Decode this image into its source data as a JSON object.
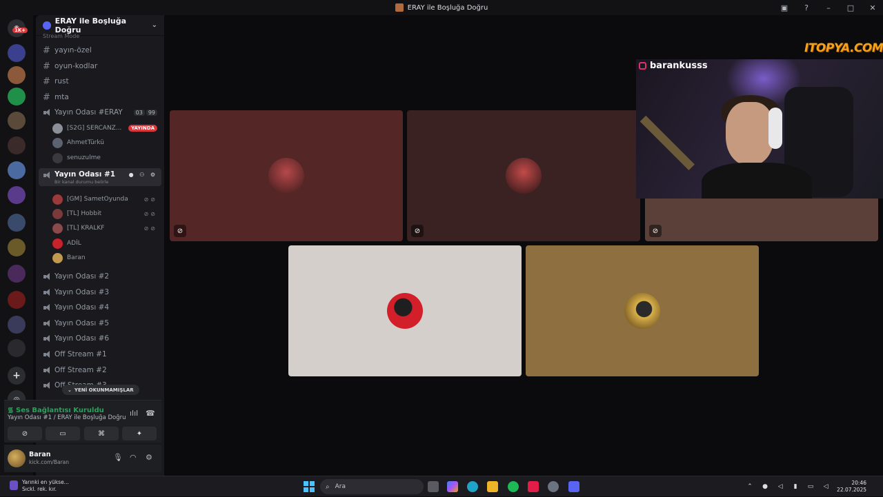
{
  "window": {
    "title": "ERAY ile Boşluğa Doğru"
  },
  "server": {
    "name": "ERAY ile Boşluğa Doğru",
    "section_label": "Stream Mode"
  },
  "server_badges": {
    "home_badge": "1K+"
  },
  "channels": {
    "text": [
      "yayın-özel",
      "oyun-kodlar",
      "rust",
      "mta"
    ],
    "voice_eray": {
      "name": "Yayın Odası #ERAY",
      "badge_a": "03",
      "badge_b": "99"
    },
    "voice_eray_users": [
      {
        "name": "[S2G] SERCANZ...",
        "live": "YAYINDA"
      },
      {
        "name": "AhmetTürkü"
      },
      {
        "name": "senuzulme"
      }
    ],
    "active_voice": {
      "name": "Yayın Odası #1",
      "status": "Bir kanal durumu belirle"
    },
    "active_users": [
      {
        "name": "[GM] SametOyunda"
      },
      {
        "name": "[TL] Hobbit"
      },
      {
        "name": "[TL] KRALKF"
      },
      {
        "name": "ADİL"
      },
      {
        "name": "Baran"
      }
    ],
    "other_voice": [
      "Yayın Odası #2",
      "Yayın Odası #3",
      "Yayın Odası #4",
      "Yayın Odası #5",
      "Yayın Odası #6",
      "Off Stream #1",
      "Off Stream #2",
      "Off Stream #3"
    ]
  },
  "new_unread": "YENİ OKUNMAMIŞLAR",
  "voice_panel": {
    "status": "Ses Bağlantısı Kuruldu",
    "channel": "Yayın Odası #1 / ERAY ile Boşluğa Doğru"
  },
  "user_panel": {
    "name": "Baran",
    "sub": "kick.com/Baran"
  },
  "overlay": {
    "instagram": "barankusss",
    "watermark": "ITOPYA.COM"
  },
  "tiles": [
    {
      "color": "#542626"
    },
    {
      "color": "#3a2222"
    },
    {
      "color": "#5a4039"
    },
    {
      "color": "#d4cfcb"
    },
    {
      "color": "#8e6f3f"
    }
  ],
  "taskbar": {
    "weather_line1": "Yarınki en yükse...",
    "weather_line2": "Sıckl. rek. kır.",
    "search_placeholder": "Ara",
    "time": "20:46",
    "date": "22.07.2025"
  }
}
